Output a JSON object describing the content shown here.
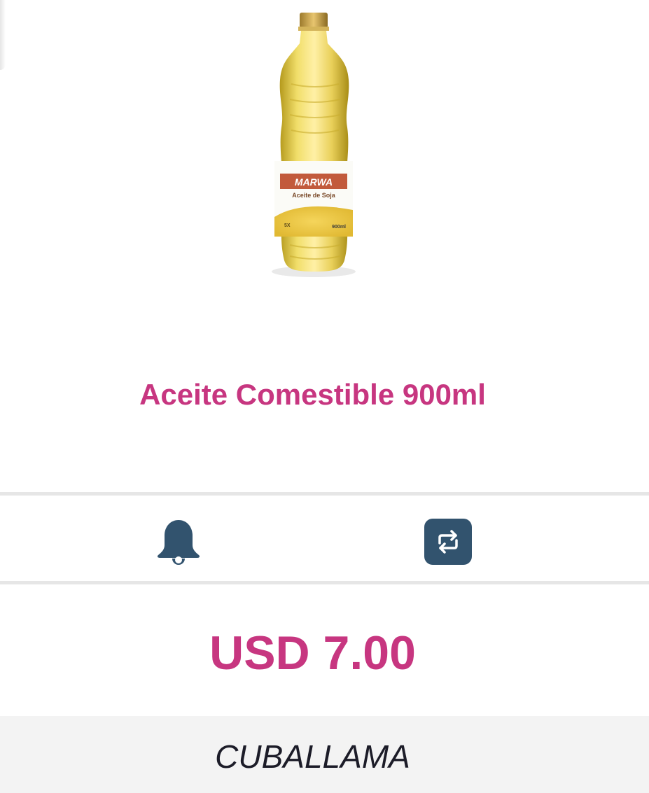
{
  "product": {
    "name": "Aceite Comestible 900ml",
    "image": {
      "icon": "oil-bottle-image",
      "label_brand": "MARWA",
      "label_text": "Aceite de Soja",
      "label_volume": "900ml",
      "label_badge": "5X"
    }
  },
  "actions": {
    "notify_icon": "bell-icon",
    "swap_icon": "swap-arrows-icon"
  },
  "price": {
    "text": "USD 7.00"
  },
  "footer": {
    "brand": "CUBALLAMA"
  },
  "colors": {
    "accent": "#c73680",
    "icon": "#32536e",
    "divider": "#e6e6e6",
    "footer_bg": "#f3f3f3"
  }
}
